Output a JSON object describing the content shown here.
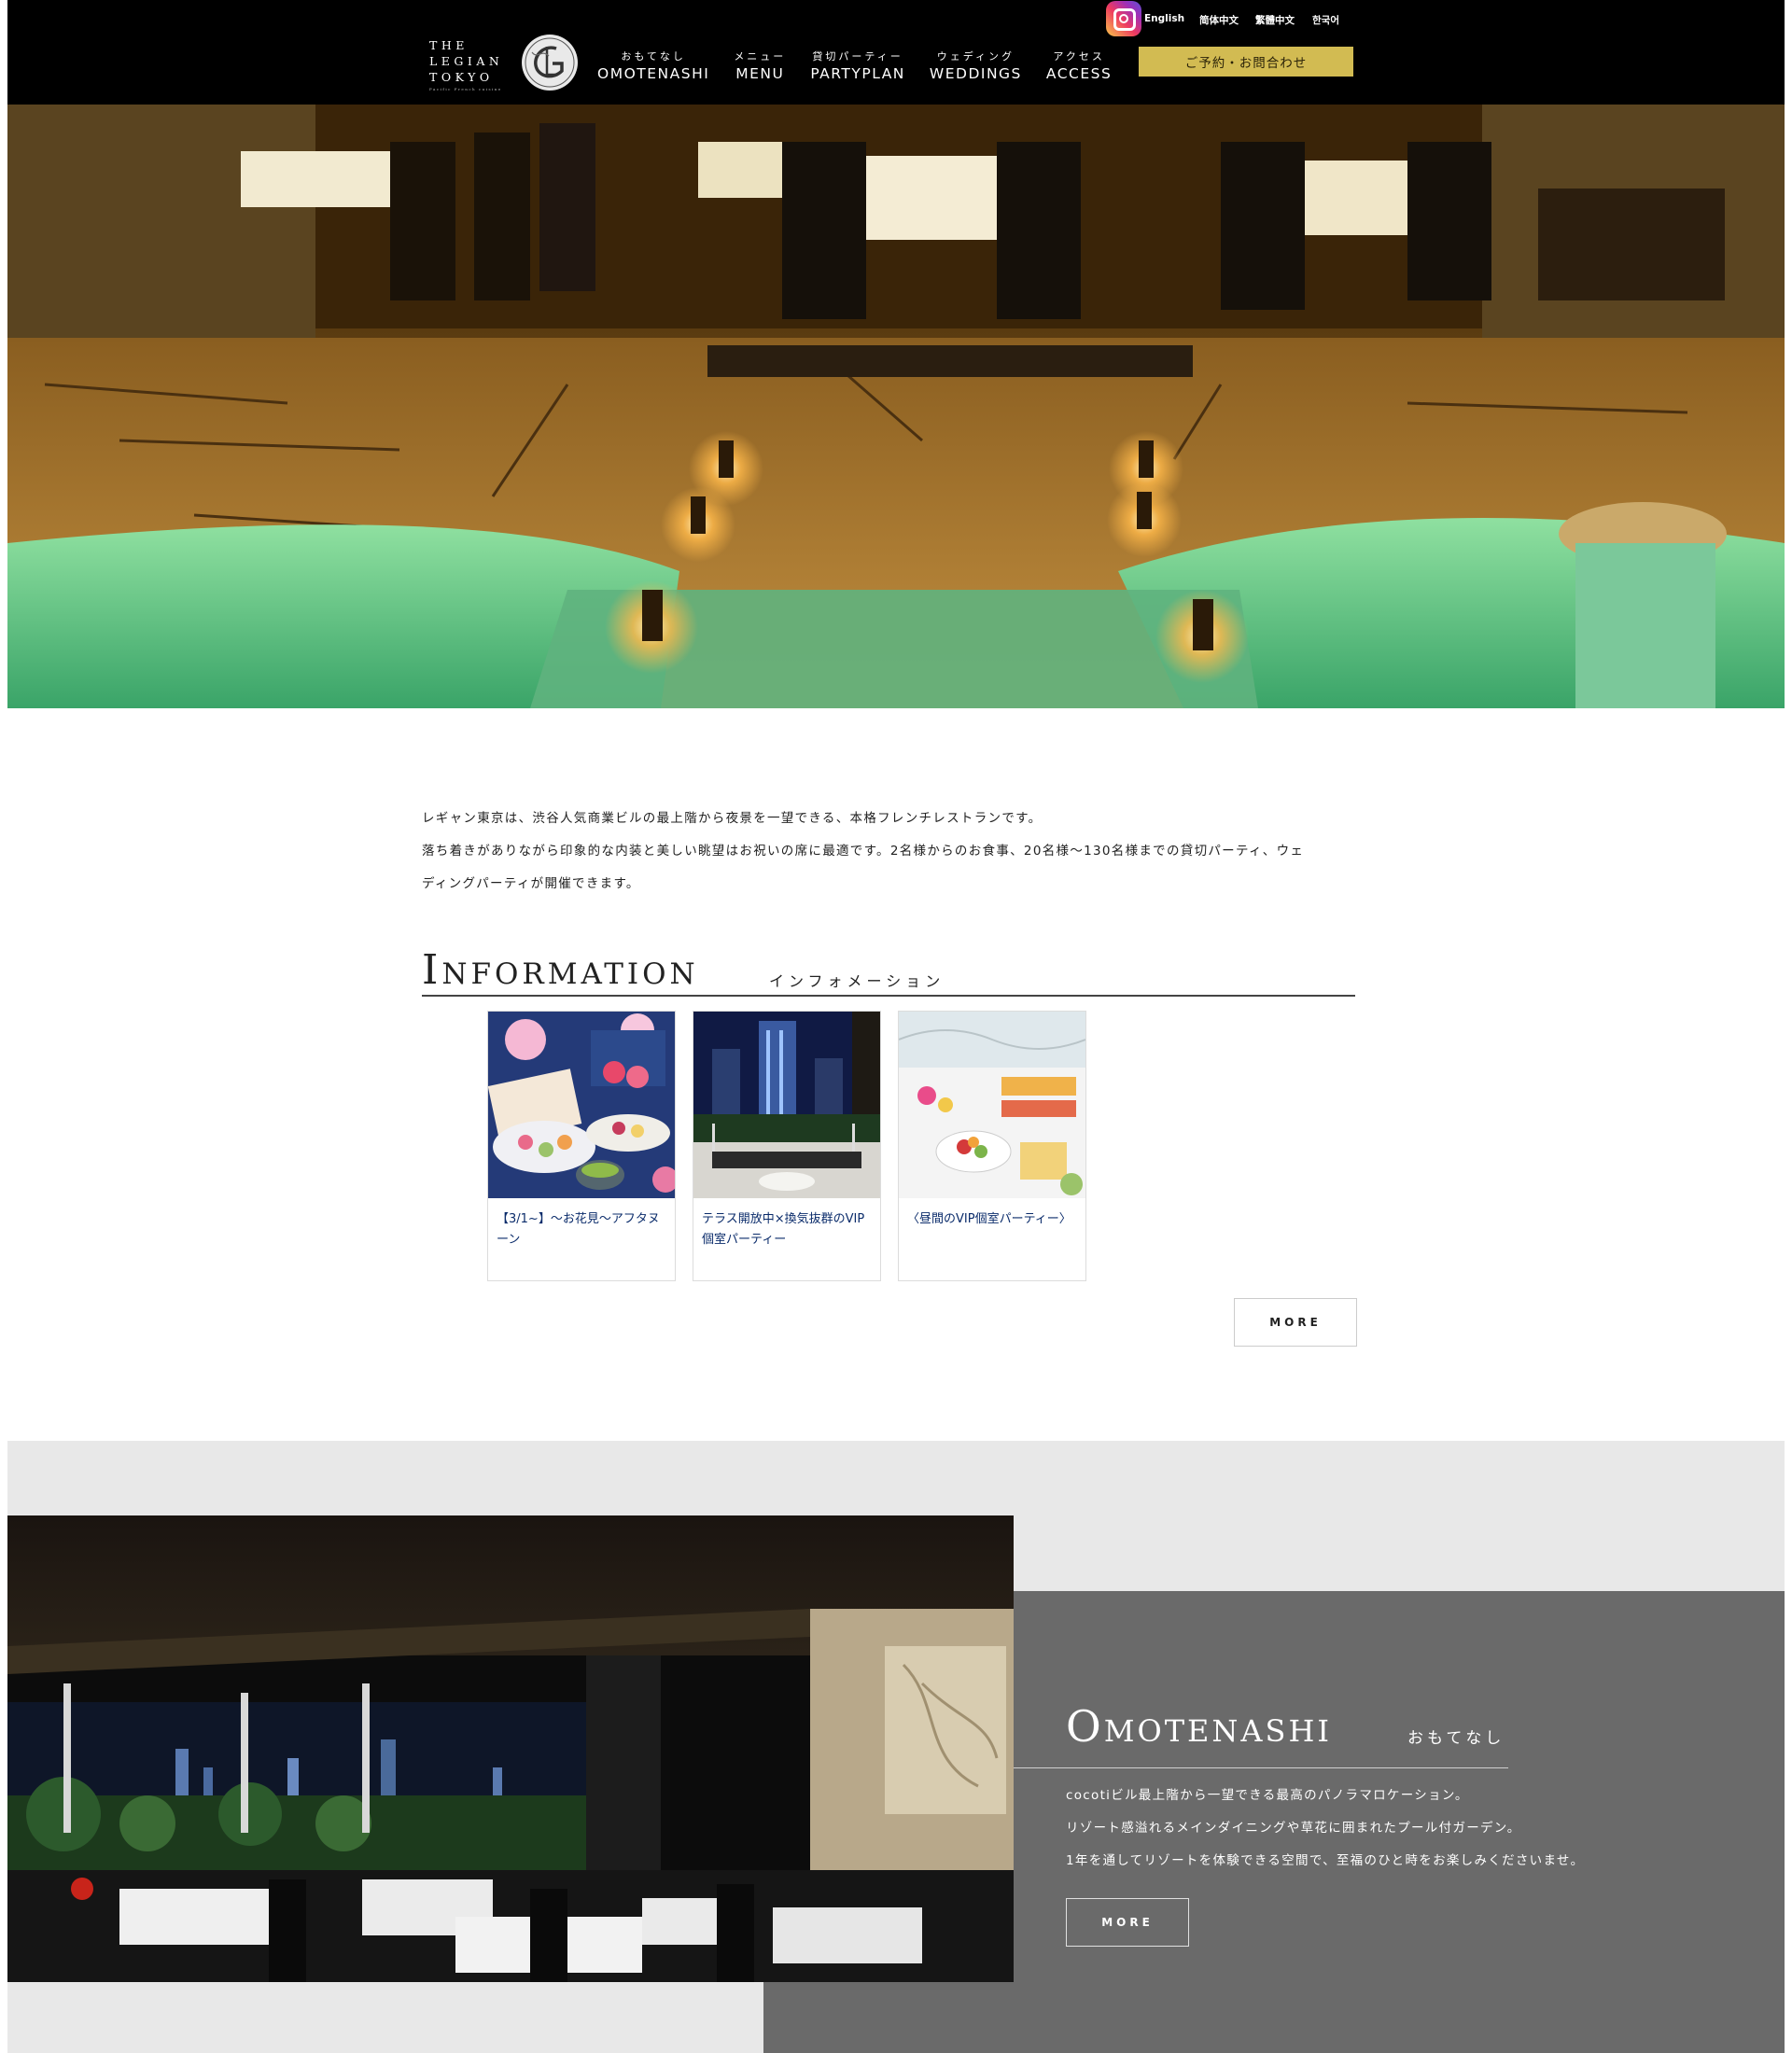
{
  "header": {
    "logo_lines": [
      "THE",
      "LEGIAN",
      "TOKYO"
    ],
    "logo_tagline": "Pacific French cuisine",
    "languages": [
      "English",
      "简体中文",
      "繁體中文",
      "한국어"
    ],
    "nav": [
      {
        "jp": "おもてなし",
        "en": "OMOTENASHI"
      },
      {
        "jp": "メニュー",
        "en": "MENU"
      },
      {
        "jp": "貸切パーティー",
        "en": "PARTYPLAN"
      },
      {
        "jp": "ウェディング",
        "en": "WEDDINGS"
      },
      {
        "jp": "アクセス",
        "en": "ACCESS"
      }
    ],
    "reserve_label": "ご予約・お問合わせ",
    "icons": {
      "instagram": "instagram-icon"
    }
  },
  "intro": {
    "line1": "レギャン東京は、渋谷人気商業ビルの最上階から夜景を一望できる、本格フレンチレストランです。",
    "line2": "落ち着きがありながら印象的な内装と美しい眺望はお祝いの席に最適です。2名様からのお食事、20名様〜130名様までの貸切パーティ、ウェ",
    "line3": "ディングパーティが開催できます。"
  },
  "information": {
    "title": "Information",
    "subtitle": "インフォメーション",
    "cards": [
      {
        "text": "【3/1~】〜お花見〜アフタヌーン"
      },
      {
        "text": "テラス開放中×換気抜群のVIP個室パーティー"
      },
      {
        "text": "〈昼間のVIP個室パーティー〉"
      }
    ],
    "more_label": "MORE"
  },
  "omotenashi": {
    "title": "Omotenashi",
    "subtitle": "おもてなし",
    "line1": "cocotiビル最上階から一望できる最高のパノラマロケーション。",
    "line2": "リゾート感溢れるメインダイニングや草花に囲まれたプール付ガーデン。",
    "line3": "1年を通してリゾートを体験できる空間で、至福のひと時をお楽しみくださいませ。",
    "more_label": "MORE"
  },
  "colors": {
    "header_bg": "#000000",
    "reserve_button": "#d2bb52",
    "card_text": "#0b2c6b",
    "omotenashi_panel": "#6a6a6a",
    "section_gray": "#e8e8e8"
  }
}
